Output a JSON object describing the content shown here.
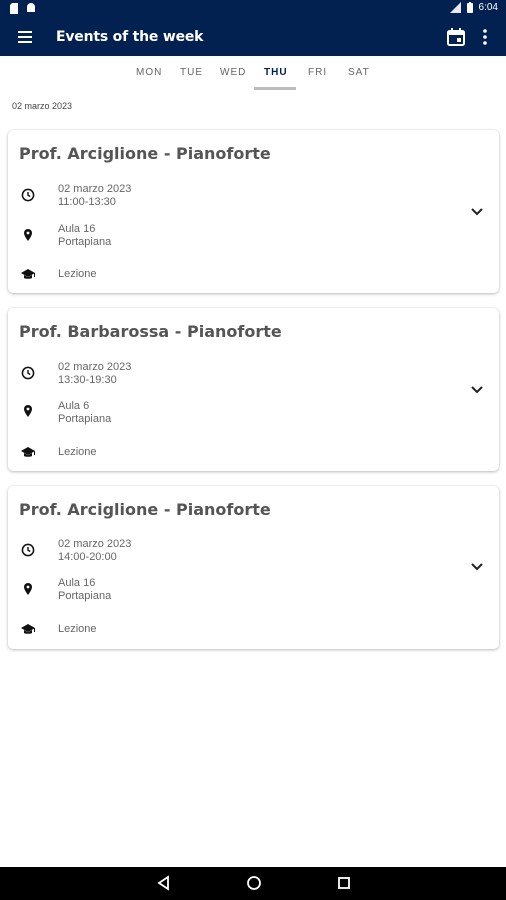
{
  "status_bar": {
    "time": "6:04"
  },
  "app_bar": {
    "title": "Events of the week"
  },
  "tabs": [
    {
      "label": "MON",
      "active": false
    },
    {
      "label": "TUE",
      "active": false
    },
    {
      "label": "WED",
      "active": false
    },
    {
      "label": "THU",
      "active": true
    },
    {
      "label": "FRI",
      "active": false
    },
    {
      "label": "SAT",
      "active": false
    }
  ],
  "selected_date": "02 marzo 2023",
  "events": [
    {
      "title": "Prof. Arciglione - Pianoforte",
      "date": "02 marzo 2023",
      "time": "11:00-13:30",
      "room": "Aula 16",
      "location": "Portapiana",
      "type": "Lezione"
    },
    {
      "title": "Prof. Barbarossa - Pianoforte",
      "date": "02 marzo 2023",
      "time": "13:30-19:30",
      "room": "Aula 6",
      "location": "Portapiana",
      "type": "Lezione"
    },
    {
      "title": "Prof. Arciglione - Pianoforte",
      "date": "02 marzo 2023",
      "time": "14:00-20:00",
      "room": "Aula 16",
      "location": "Portapiana",
      "type": "Lezione"
    }
  ],
  "colors": {
    "primary": "#032150",
    "text_secondary": "#666666"
  }
}
